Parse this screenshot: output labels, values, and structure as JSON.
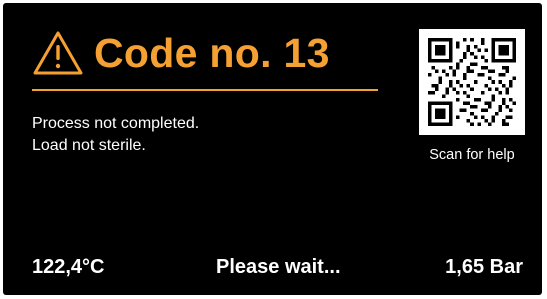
{
  "colors": {
    "accent": "#f5a033",
    "background": "#000000",
    "text": "#ffffff"
  },
  "error": {
    "icon": "warning-icon",
    "title": "Code no. 13"
  },
  "message": {
    "line1": "Process not completed.",
    "line2": "Load not sterile."
  },
  "help": {
    "icon": "qr-code-icon",
    "caption": "Scan for help"
  },
  "status": {
    "temperature": "122,4°C",
    "state": "Please wait...",
    "pressure": "1,65 Bar"
  }
}
